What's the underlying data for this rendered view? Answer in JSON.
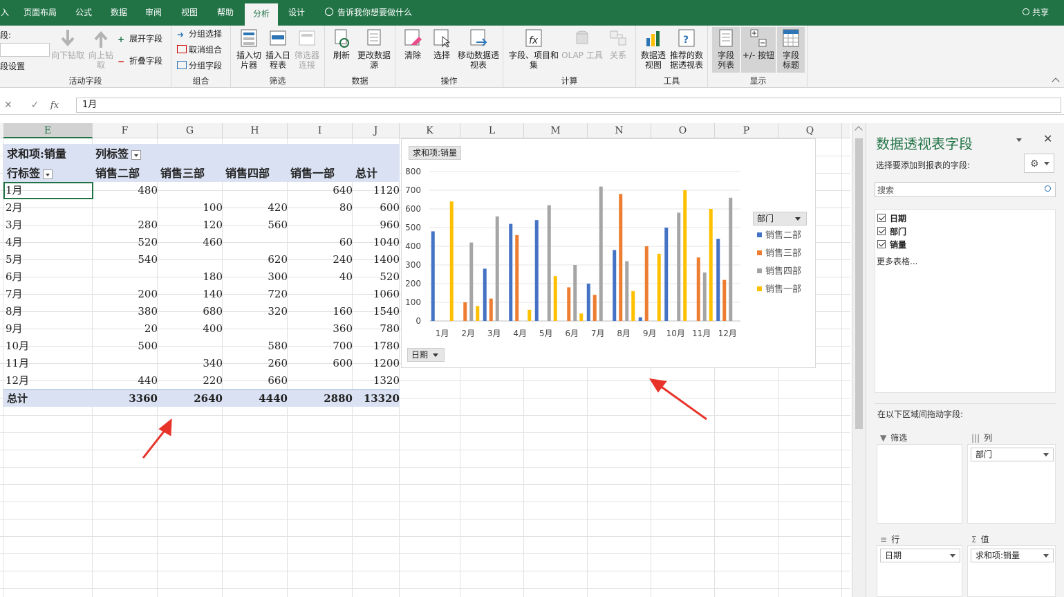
{
  "tabs": {
    "partial": "入",
    "layout": "页面布局",
    "formula": "公式",
    "data": "数据",
    "review": "审阅",
    "view": "视图",
    "help": "帮助",
    "analyze": "分析",
    "design": "设计",
    "tell_me": "告诉我你想要做什么",
    "share": "共享"
  },
  "ribbon": {
    "active_field": {
      "label_partial": "段:",
      "settings_partial": "段设置",
      "drill_down": "向下钻取",
      "drill_up": "向上钻取",
      "expand": "展开字段",
      "collapse": "折叠字段",
      "group_label": "活动字段"
    },
    "group": {
      "group_selection": "分组选择",
      "ungroup": "取消组合",
      "group_field": "分组字段",
      "group_label": "组合"
    },
    "filter": {
      "insert_slicer": "插入切片器",
      "insert_timeline": "插入日程表",
      "filter_connections": "筛选器连接",
      "group_label": "筛选"
    },
    "data": {
      "refresh": "刷新",
      "change_source": "更改数据源",
      "group_label": "数据"
    },
    "actions": {
      "clear": "清除",
      "select": "选择",
      "move_pivot": "移动数据透视表",
      "group_label": "操作"
    },
    "calc": {
      "fields_items": "字段、项目和集",
      "olap": "OLAP 工具",
      "relations": "关系",
      "group_label": "计算"
    },
    "tools": {
      "pivot_chart": "数据透视图",
      "recommended": "推荐的数据透视表",
      "group_label": "工具"
    },
    "show": {
      "field_list": "字段列表",
      "buttons": "+/- 按钮",
      "headers": "字段标题",
      "group_label": "显示"
    }
  },
  "formula_bar": {
    "value": "1月"
  },
  "columns": [
    "E",
    "F",
    "G",
    "H",
    "I",
    "J",
    "K",
    "L",
    "M",
    "N",
    "O",
    "P",
    "Q"
  ],
  "pivot": {
    "corner": "求和项:销量",
    "col_label": "列标签",
    "row_label": "行标签",
    "headers": [
      "销售二部",
      "销售三部",
      "销售四部",
      "销售一部",
      "总计"
    ],
    "rows": [
      {
        "label": "1月",
        "v": [
          "480",
          "",
          "",
          "640",
          "1120"
        ]
      },
      {
        "label": "2月",
        "v": [
          "",
          "100",
          "420",
          "80",
          "600"
        ]
      },
      {
        "label": "3月",
        "v": [
          "280",
          "120",
          "560",
          "",
          "960"
        ]
      },
      {
        "label": "4月",
        "v": [
          "520",
          "460",
          "",
          "60",
          "1040"
        ]
      },
      {
        "label": "5月",
        "v": [
          "540",
          "",
          "620",
          "240",
          "1400"
        ]
      },
      {
        "label": "6月",
        "v": [
          "",
          "180",
          "300",
          "40",
          "520"
        ]
      },
      {
        "label": "7月",
        "v": [
          "200",
          "140",
          "720",
          "",
          "1060"
        ]
      },
      {
        "label": "8月",
        "v": [
          "380",
          "680",
          "320",
          "160",
          "1540"
        ]
      },
      {
        "label": "9月",
        "v": [
          "20",
          "400",
          "",
          "360",
          "780"
        ]
      },
      {
        "label": "10月",
        "v": [
          "500",
          "",
          "580",
          "700",
          "1780"
        ]
      },
      {
        "label": "11月",
        "v": [
          "",
          "340",
          "260",
          "600",
          "1200"
        ]
      },
      {
        "label": "12月",
        "v": [
          "440",
          "220",
          "660",
          "",
          "1320"
        ]
      }
    ],
    "total": {
      "label": "总计",
      "v": [
        "3360",
        "2640",
        "4440",
        "2880",
        "13320"
      ]
    }
  },
  "chart_data": {
    "type": "bar",
    "title_chip": "求和项:销量",
    "axis_chip": "日期",
    "legend_title": "部门",
    "legend_placement": "right",
    "categories": [
      "1月",
      "2月",
      "3月",
      "4月",
      "5月",
      "6月",
      "7月",
      "8月",
      "9月",
      "10月",
      "11月",
      "12月"
    ],
    "ylim": [
      0,
      800
    ],
    "yticks": [
      "0",
      "100",
      "200",
      "300",
      "400",
      "500",
      "600",
      "700",
      "800"
    ],
    "grid": true,
    "series": [
      {
        "name": "销售二部",
        "color": "#4472C4",
        "values": [
          480,
          0,
          280,
          520,
          540,
          0,
          200,
          380,
          20,
          500,
          0,
          440
        ]
      },
      {
        "name": "销售三部",
        "color": "#ED7D31",
        "values": [
          0,
          100,
          120,
          460,
          0,
          180,
          140,
          680,
          400,
          0,
          340,
          220
        ]
      },
      {
        "name": "销售四部",
        "color": "#A5A5A5",
        "values": [
          0,
          420,
          560,
          0,
          620,
          300,
          720,
          320,
          0,
          580,
          260,
          660
        ]
      },
      {
        "name": "销售一部",
        "color": "#FFC000",
        "values": [
          640,
          80,
          0,
          60,
          240,
          40,
          0,
          160,
          360,
          700,
          600,
          0
        ]
      }
    ]
  },
  "panel": {
    "title": "数据透视表字段",
    "subtitle": "选择要添加到报表的字段:",
    "search_placeholder": "搜索",
    "fields": [
      "日期",
      "部门",
      "销量"
    ],
    "more_tables": "更多表格...",
    "drag_hint": "在以下区域间拖动字段:",
    "areas": {
      "filter": "筛选",
      "columns": "列",
      "rows": "行",
      "values": "值"
    },
    "col_field": "部门",
    "row_field": "日期",
    "value_field": "求和项:销量"
  },
  "colors": {
    "excel_green": "#217346",
    "pivot_header_bg": "#D9E1F2",
    "arrow_red": "#E8332A"
  }
}
